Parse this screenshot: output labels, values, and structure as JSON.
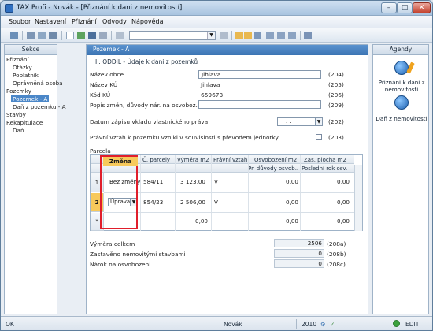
{
  "window": {
    "title": "TAX Profi - Novák - [Přiznání k dani z nemovitostí]"
  },
  "menubar": {
    "items": [
      "Soubor",
      "Nastavení",
      "Přiznání",
      "Odvody",
      "Nápověda"
    ]
  },
  "sidebar": {
    "header": "Sekce",
    "items": [
      {
        "label": "Přiznání",
        "level": 0
      },
      {
        "label": "Otázky",
        "level": 1
      },
      {
        "label": "Poplatník",
        "level": 1
      },
      {
        "label": "Oprávněná osoba",
        "level": 1
      },
      {
        "label": "Pozemky",
        "level": 0
      },
      {
        "label": "Pozemek - A",
        "level": 1,
        "selected": true
      },
      {
        "label": "Daň z pozemku - A",
        "level": 1
      },
      {
        "label": "Stavby",
        "level": 0
      },
      {
        "label": "Rekapitulace",
        "level": 0
      },
      {
        "label": "Daň",
        "level": 1
      }
    ]
  },
  "content": {
    "header": "Pozemek - A",
    "section_title": "II. ODDÍL - Údaje k dani z pozemků",
    "fields": {
      "nazev_obce": {
        "label": "Název obce",
        "value": "Jihlava",
        "code": "(204)"
      },
      "nazev_ku": {
        "label": "Název KÚ",
        "value": "Jihlava",
        "code": "(205)"
      },
      "kod_ku": {
        "label": "Kód KÚ",
        "value": "659673",
        "code": "(206)"
      },
      "popis": {
        "label": "Popis změn, důvody nár. na osvoboz.",
        "value": "",
        "code": "(209)"
      },
      "datum": {
        "label": "Datum zápisu vkladu vlastnického práva",
        "value": ". .",
        "code": "(202)"
      },
      "pravni": {
        "label": "Právní vztah k pozemku vznikl v souvislosti s převodem jednotky",
        "code": "(203)"
      }
    },
    "parcela_label": "Parcela",
    "grid": {
      "headers": [
        "Změna",
        "Č. parcely",
        "Výměra m2",
        "Právní vztah",
        "Osvobození m2",
        "Zas. plocha m2"
      ],
      "subheaders": [
        "Pr. důvody osvob..",
        "Poslední rok osv."
      ],
      "rows": [
        {
          "num": "1",
          "zmena": "Bez změny",
          "parcela": "584/11",
          "vymera": "3 123,00",
          "vztah": "V",
          "osvob": "0,00",
          "plocha": "0,00"
        },
        {
          "num": "2",
          "zmena": "Úprava",
          "parcela": "854/23",
          "vymera": "2 506,00",
          "vztah": "V",
          "osvob": "0,00",
          "plocha": "0,00"
        },
        {
          "num": "*",
          "zmena": "",
          "parcela": "",
          "vymera": "0,00",
          "vztah": "",
          "osvob": "0,00",
          "plocha": "0,00"
        }
      ]
    },
    "summary": [
      {
        "label": "Výměra celkem",
        "value": "2506",
        "code": "(208a)"
      },
      {
        "label": "Zastavěno nemovitými stavbami",
        "value": "0",
        "code": "(208b)"
      },
      {
        "label": "Nárok na osvobození",
        "value": "0",
        "code": "(208c)"
      }
    ]
  },
  "agendy": {
    "header": "Agendy",
    "items": [
      {
        "label": "Přiznání k dani z nemovitostí",
        "icon": "agenda-icon"
      },
      {
        "label": "Daň z nemovitostí",
        "icon": "agenda-icon"
      }
    ]
  },
  "statusbar": {
    "ok": "OK",
    "user": "Novák",
    "year": "2010",
    "mode": "EDIT"
  },
  "colors": {
    "accent": "#3b74b3",
    "highlight": "#e01e2b",
    "active_row": "#f7c95b"
  }
}
